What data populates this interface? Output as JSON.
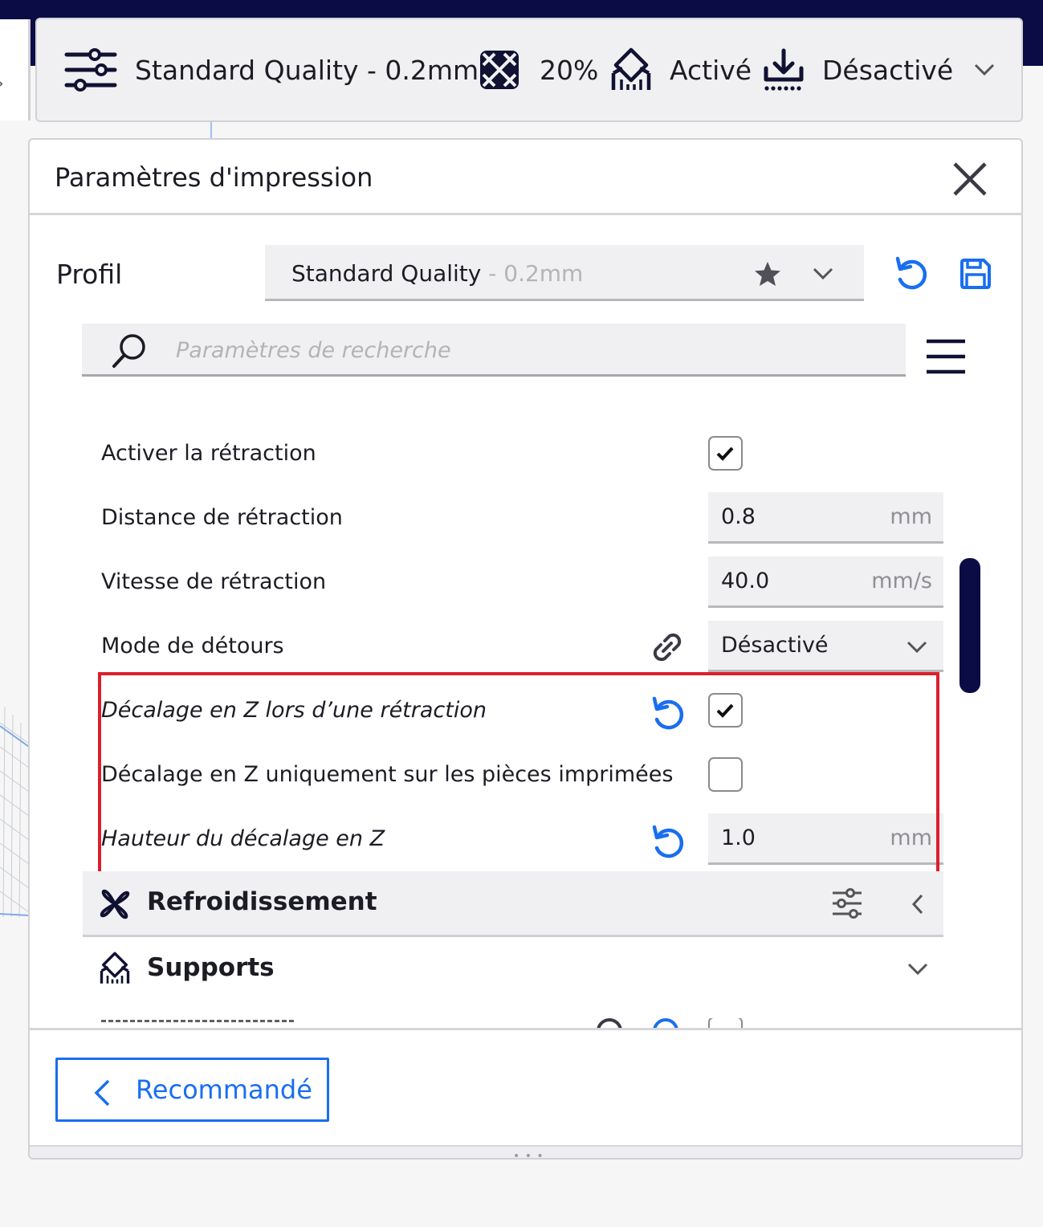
{
  "toolbar": {
    "profile": "Standard Quality - 0.2mm",
    "infill": "20%",
    "support": "Activé",
    "adhesion": "Désactivé"
  },
  "panel": {
    "title": "Paramètres d'impression",
    "profil_label": "Profil",
    "profile_name": "Standard Quality",
    "profile_sub": " - 0.2mm",
    "search_placeholder": "Paramètres de recherche"
  },
  "settings": [
    {
      "label": "Activer la rétraction",
      "type": "checkbox",
      "checked": true
    },
    {
      "label": "Distance de rétraction",
      "type": "number",
      "value": "0.8",
      "unit": "mm"
    },
    {
      "label": "Vitesse de rétraction",
      "type": "number",
      "value": "40.0",
      "unit": "mm/s"
    },
    {
      "label": "Mode de détours",
      "type": "select",
      "value": "Désactivé"
    },
    {
      "label": "Décalage en Z lors d’une rétraction",
      "type": "checkbox",
      "checked": true
    },
    {
      "label": "Décalage en Z uniquement sur les pièces imprimées",
      "type": "checkbox",
      "checked": false
    },
    {
      "label": "Hauteur du décalage en Z",
      "type": "number",
      "value": "1.0",
      "unit": "mm"
    }
  ],
  "categories": {
    "cooling": "Refroidissement",
    "supports": "Supports"
  },
  "footer": {
    "recommended": "Recommandé"
  },
  "colors": {
    "accent_blue": "#196ef0",
    "navy": "#0b0b45",
    "highlight_red": "#dc1f2c"
  }
}
